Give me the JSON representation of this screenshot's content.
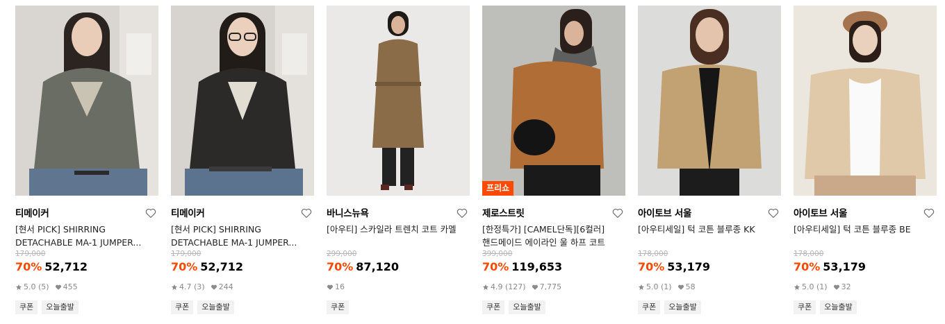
{
  "products": [
    {
      "brand": "티메이커",
      "name_line1": "[현서 PICK] SHIRRING",
      "name_line2": "DETACHABLE MA-1 JUMPER...",
      "original_price": "179,000",
      "discount": "70%",
      "price": "52,712",
      "rating": "5.0 (5)",
      "likes": "455",
      "tags": [
        "쿠폰",
        "오늘출발"
      ]
    },
    {
      "brand": "티메이커",
      "name_line1": "[현서 PICK] SHIRRING",
      "name_line2": "DETACHABLE MA-1 JUMPER...",
      "original_price": "179,000",
      "discount": "70%",
      "price": "52,712",
      "rating": "4.7 (3)",
      "likes": "244",
      "tags": [
        "쿠폰",
        "오늘출발"
      ]
    },
    {
      "brand": "바니스뉴욕",
      "name_line1": "[아우티] 스카일라 트렌치 코트 카멜",
      "name_line2": "",
      "original_price": "299,000",
      "discount": "70%",
      "price": "87,120",
      "rating": "",
      "likes": "16",
      "tags": [
        "쿠폰"
      ]
    },
    {
      "brand": "제로스트릿",
      "badge": "프리쇼",
      "name_line1": "[한정특가] [CAMEL단독][6컬러]",
      "name_line2": "핸드메이드 에이라인 울 하프 코트",
      "original_price": "399,000",
      "discount": "70%",
      "price": "119,653",
      "rating": "4.9 (127)",
      "likes": "7,775",
      "tags": [
        "쿠폰",
        "오늘출발"
      ]
    },
    {
      "brand": "아이토브 서울",
      "name_line1": "[아우티세일] 턱 코튼 블루종 KK",
      "name_line2": "",
      "original_price": "178,000",
      "discount": "70%",
      "price": "53,179",
      "rating": "5.0 (1)",
      "likes": "58",
      "tags": [
        "쿠폰",
        "오늘출발"
      ]
    },
    {
      "brand": "아이토브 서울",
      "name_line1": "[아우티세일] 턱 코튼 블루종 BE",
      "name_line2": "",
      "original_price": "178,000",
      "discount": "70%",
      "price": "53,179",
      "rating": "5.0 (1)",
      "likes": "32",
      "tags": [
        "쿠폰",
        "오늘출발"
      ]
    }
  ],
  "colors": {
    "accent": "#ff4800",
    "muted": "#8a8a8a",
    "tag_bg": "#f2f2f2"
  },
  "icons": {
    "like": "heart-outline-icon",
    "rating": "star-icon",
    "likes_count": "heart-filled-icon"
  }
}
